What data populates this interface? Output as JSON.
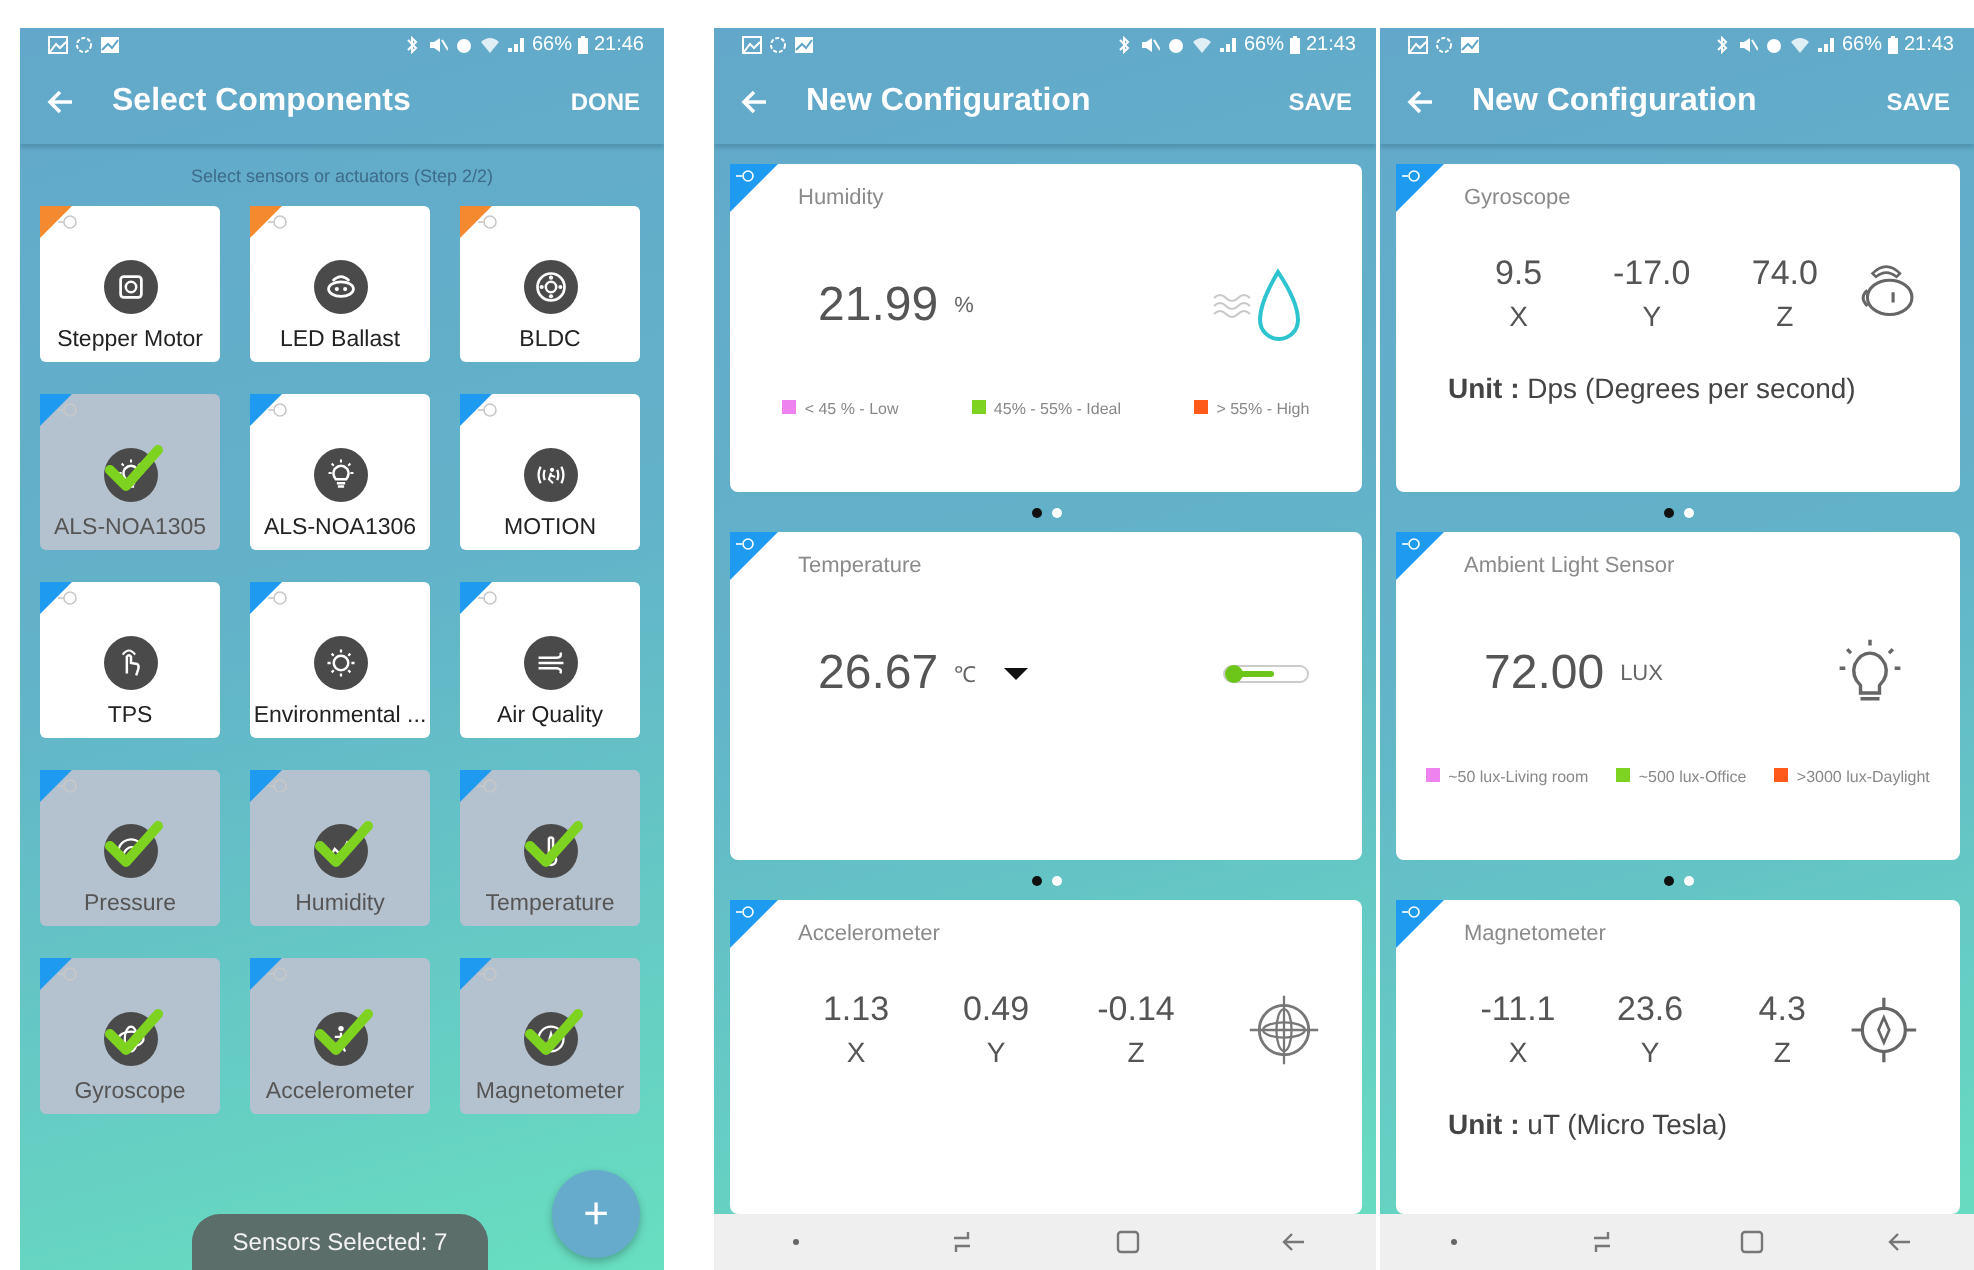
{
  "screens": [
    {
      "kind": "select",
      "status": {
        "battery": "66%",
        "time": "21:46"
      },
      "app_bar": {
        "title": "Select Components",
        "action": "DONE"
      },
      "subtitle": "Select sensors or actuators (Step 2/2)",
      "components": [
        {
          "label": "Stepper Motor",
          "kind": "stepper",
          "color": "#f5892f",
          "selected": false
        },
        {
          "label": "LED Ballast",
          "kind": "led",
          "color": "#f5892f",
          "selected": false
        },
        {
          "label": "BLDC",
          "kind": "bldc",
          "color": "#f5892f",
          "selected": false
        },
        {
          "label": "ALS-NOA1305",
          "kind": "light",
          "color": "#1e9bf0",
          "selected": true
        },
        {
          "label": "ALS-NOA1306",
          "kind": "light",
          "color": "#1e9bf0",
          "selected": false
        },
        {
          "label": "MOTION",
          "kind": "motion",
          "color": "#1e9bf0",
          "selected": false
        },
        {
          "label": "TPS",
          "kind": "touch",
          "color": "#1e9bf0",
          "selected": false
        },
        {
          "label": "Environmental ...",
          "kind": "environment",
          "color": "#1e9bf0",
          "selected": false
        },
        {
          "label": "Air Quality",
          "kind": "air",
          "color": "#1e9bf0",
          "selected": false
        },
        {
          "label": "Pressure",
          "kind": "pressure",
          "color": "#1e9bf0",
          "selected": true
        },
        {
          "label": "Humidity",
          "kind": "humidity",
          "color": "#1e9bf0",
          "selected": true
        },
        {
          "label": "Temperature",
          "kind": "temperature",
          "color": "#1e9bf0",
          "selected": true
        },
        {
          "label": "Gyroscope",
          "kind": "gyroscope",
          "color": "#1e9bf0",
          "selected": true
        },
        {
          "label": "Accelerometer",
          "kind": "accelerometer",
          "color": "#1e9bf0",
          "selected": true
        },
        {
          "label": "Magnetometer",
          "kind": "magnetometer",
          "color": "#1e9bf0",
          "selected": true
        }
      ],
      "toast": "Sensors Selected: 7",
      "fab": "+"
    },
    {
      "kind": "config",
      "status": {
        "battery": "66%",
        "time": "21:43"
      },
      "app_bar": {
        "title": "New Configuration",
        "action": "SAVE"
      },
      "cards": [
        {
          "kind": "humidity",
          "title": "Humidity",
          "value": "21.99",
          "unit": "%",
          "legend": [
            {
              "label": "< 45 % - Low",
              "color": "#ee82ee"
            },
            {
              "label": "45% - 55% - Ideal",
              "color": "#7ed321"
            },
            {
              "label": "> 55% - High",
              "color": "#ff5a1a"
            }
          ],
          "pages": [
            {
              "selected": true
            },
            {
              "selected": false
            }
          ]
        },
        {
          "kind": "temperature",
          "title": "Temperature",
          "value": "26.67",
          "unit": "℃",
          "pages": [
            {
              "selected": true
            },
            {
              "selected": false
            }
          ]
        },
        {
          "kind": "accelerometer",
          "title": "Accelerometer",
          "axes": [
            {
              "value": "1.13",
              "label": "X"
            },
            {
              "value": "0.49",
              "label": "Y"
            },
            {
              "value": "-0.14",
              "label": "Z"
            }
          ]
        }
      ]
    },
    {
      "kind": "config",
      "status": {
        "battery": "66%",
        "time": "21:43"
      },
      "app_bar": {
        "title": "New Configuration",
        "action": "SAVE"
      },
      "cards": [
        {
          "kind": "gyroscope",
          "title": "Gyroscope",
          "axes": [
            {
              "value": "9.5",
              "label": "X"
            },
            {
              "value": "-17.0",
              "label": "Y"
            },
            {
              "value": "74.0",
              "label": "Z"
            }
          ],
          "unit_text": "**Unit :** Dps (Degrees per second)",
          "pages": [
            {
              "selected": true
            },
            {
              "selected": false
            }
          ]
        },
        {
          "kind": "light",
          "title": "Ambient Light Sensor",
          "value": "72.00",
          "unit": "LUX",
          "legend": [
            {
              "label": "~50 lux-Living room",
              "color": "#ee82ee"
            },
            {
              "label": "~500 lux-Office",
              "color": "#7ed321"
            },
            {
              "label": ">3000 lux-Daylight",
              "color": "#ff5a1a"
            }
          ],
          "pages": [
            {
              "selected": true
            },
            {
              "selected": false
            }
          ]
        },
        {
          "kind": "magnetometer",
          "title": "Magnetometer",
          "axes": [
            {
              "value": "-11.1",
              "label": "X"
            },
            {
              "value": "23.6",
              "label": "Y"
            },
            {
              "value": "4.3",
              "label": "Z"
            }
          ],
          "unit_text": "**Unit :** uT (Micro Tesla)"
        }
      ]
    }
  ]
}
